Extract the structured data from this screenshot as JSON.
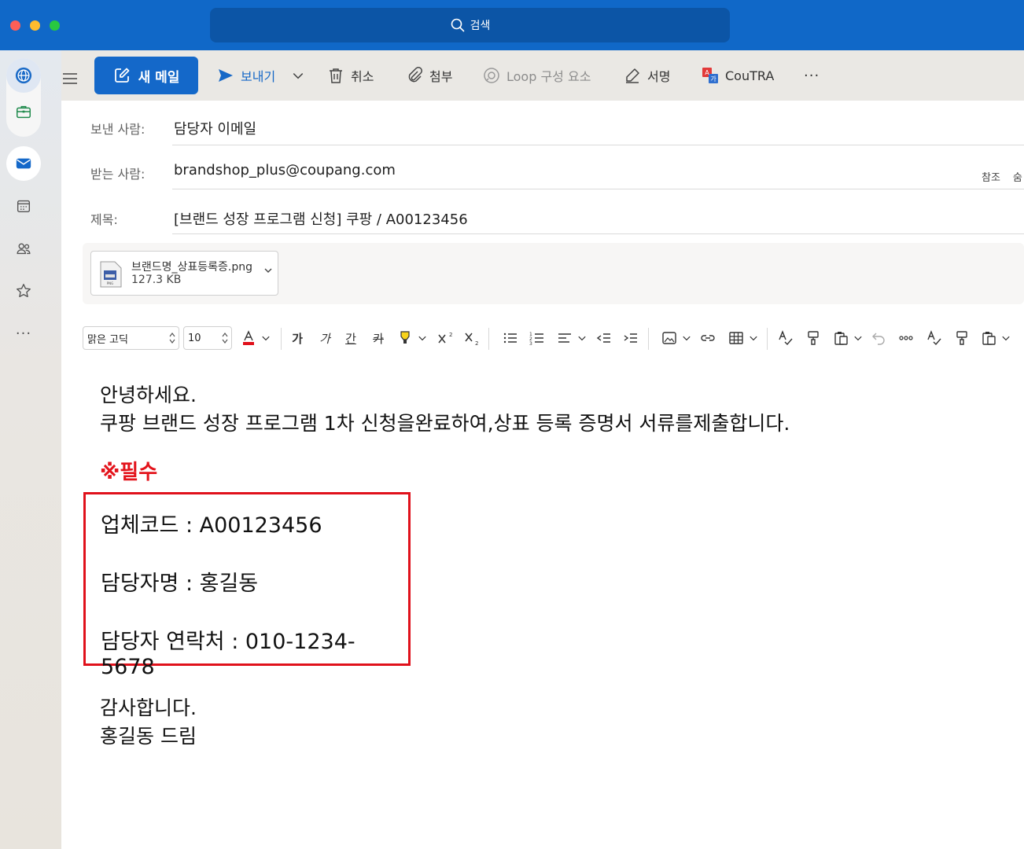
{
  "titlebar": {
    "search_placeholder": "검색"
  },
  "toolbar": {
    "new_mail": "새 메일",
    "send": "보내기",
    "cancel": "취소",
    "attach": "첨부",
    "loop": "Loop 구성 요소",
    "signature": "서명",
    "coutra": "CouTRA",
    "more": "···"
  },
  "fields": {
    "from_label": "보낸 사람:",
    "from_value": "담당자 이메일",
    "to_label": "받는 사람:",
    "to_value": "brandshop_plus@coupang.com",
    "cc": "참조",
    "bcc": "숨",
    "subject_label": "제목:",
    "subject_value": "[브랜드 성장 프로그램 신청] 쿠팡 / A00123456"
  },
  "attachment": {
    "name": "브랜드명_상표등록증.png",
    "size": "127.3 KB"
  },
  "format_toolbar": {
    "font": "맑은 고딕",
    "size": "10",
    "bold": "가",
    "italic": "가",
    "underline": "간",
    "strike": "카"
  },
  "body": {
    "greeting": "안녕하세요.",
    "intro": "쿠팡 브랜드 성장 프로그램 1차 신청을완료하여,상표 등록 증명서 서류를제출합니다.",
    "required": "※필수",
    "vendor_code": "업체코드 : A00123456",
    "manager_name": "담당자명 : 홍길동",
    "manager_contact": "담당자 연락처 : 010-1234-5678",
    "thanks": "감사합니다.",
    "closing": "홍길동 드림"
  },
  "colors": {
    "titlebar": "#1068c8",
    "accent": "#1468c9",
    "required_red": "#e3131b"
  },
  "icons": [
    "search-icon",
    "globe-icon",
    "briefcase-icon",
    "mail-icon",
    "calendar-icon",
    "people-icon",
    "star-icon",
    "hamburger-icon",
    "compose-icon",
    "send-icon",
    "chevron-down-icon",
    "trash-icon",
    "paperclip-icon",
    "loop-icon",
    "pen-icon",
    "translate-icon"
  ]
}
